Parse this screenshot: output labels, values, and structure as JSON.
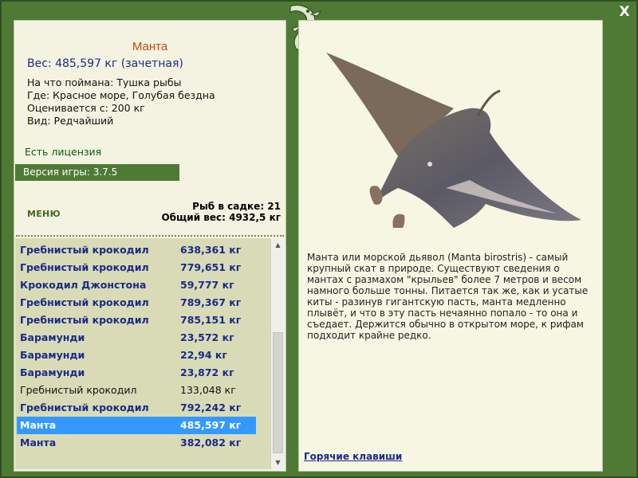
{
  "window": {
    "close_label": "X"
  },
  "fish": {
    "name": "Манта",
    "weight_line": "Вес: 485,597 кг (зачетная)",
    "info": [
      "На что поймана: Тушка рыбы",
      "Где: Красное море, Голубая бездна",
      "Оценивается с: 200 кг",
      "Вид: Редчайший"
    ],
    "description": "Манта или морской дьявол (Manta birostris) - самый крупный скат в природе. Существуют сведения о мантах с размахом \"крыльев\" более 7 метров и весом намного больше тонны. Питается так же, как и усатые киты - разинув гигантскую пасть, манта медленно плывёт, и что в эту пасть нечаянно попало - то она и съедает. Держится обычно в открытом море, к рифам подходит крайне редко."
  },
  "license": "Есть лицензия",
  "version": "Версия игры: 3.7.5",
  "menu_label": "МЕНЮ",
  "stats": {
    "fish_in_keep": "Рыб в садке: 21",
    "total_weight": "Общий вес: 4932,5 кг"
  },
  "catch_list": [
    {
      "name": "Гребнистый крокодил",
      "weight": "638,361 кг"
    },
    {
      "name": "Гребнистый крокодил",
      "weight": "779,651 кг"
    },
    {
      "name": "Крокодил Джонстона",
      "weight": "59,777 кг"
    },
    {
      "name": "Гребнистый крокодил",
      "weight": "789,367 кг"
    },
    {
      "name": "Гребнистый крокодил",
      "weight": "785,151 кг"
    },
    {
      "name": "Барамунди",
      "weight": "23,572 кг"
    },
    {
      "name": "Барамунди",
      "weight": "22,94 кг"
    },
    {
      "name": "Барамунди",
      "weight": "23,872 кг"
    },
    {
      "name": "Гребнистый крокодил",
      "weight": "133,048 кг"
    },
    {
      "name": "Гребнистый крокодил",
      "weight": "792,242 кг"
    },
    {
      "name": "Манта",
      "weight": "485,597 кг"
    },
    {
      "name": "Манта",
      "weight": "382,082 кг"
    }
  ],
  "hotkeys_label": "Горячие клавиши",
  "colors": {
    "frame": "#4e7a35",
    "panel": "#f4f3e1",
    "list_bg": "#d9dbb7",
    "selection": "#3399ff",
    "accent_name": "#c04a10",
    "link": "#1a2a88"
  }
}
